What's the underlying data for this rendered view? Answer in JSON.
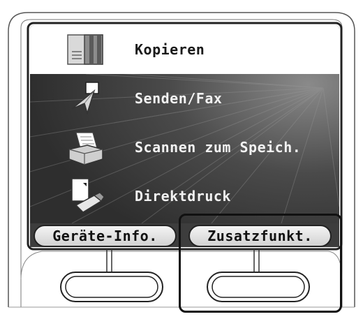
{
  "menu": {
    "items": [
      {
        "label": "Kopieren",
        "icon": "copier-document-icon",
        "selected": true
      },
      {
        "label": "Senden/Fax",
        "icon": "send-arrow-icon",
        "selected": false
      },
      {
        "label": "Scannen zum Speich.",
        "icon": "scanner-tray-icon",
        "selected": false
      },
      {
        "label": "Direktdruck",
        "icon": "usb-memory-icon",
        "selected": false
      }
    ]
  },
  "softkeys": {
    "left_label": "Geräte-Info.",
    "right_label": "Zusatzfunkt."
  },
  "colors": {
    "screen_background": "#3d3d3d",
    "selected_row": "#ffffff",
    "menu_text": "#f2f2f2"
  }
}
